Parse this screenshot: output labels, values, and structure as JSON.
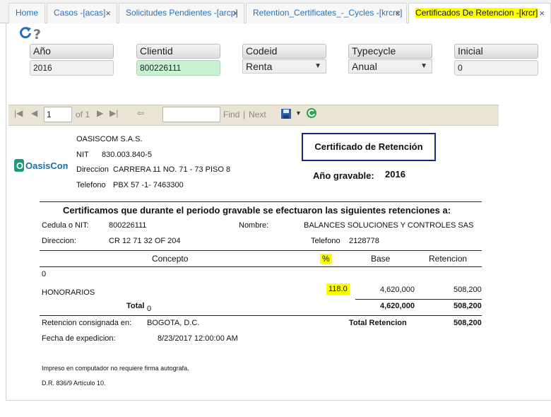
{
  "tabs": [
    {
      "label": "Home"
    },
    {
      "label": "Casos -[acas]"
    },
    {
      "label": "Solicitudes Pendientes -[arcp]"
    },
    {
      "label": "Retention_Certificates_-_Cycles -[krcrc]"
    },
    {
      "label": "Certificados De Retencion -[krcr]"
    }
  ],
  "params": {
    "anio": {
      "label": "Año",
      "value": "2016"
    },
    "clientid": {
      "label": "Clientid",
      "value": "800226111"
    },
    "codeid": {
      "label": "Codeid",
      "value": "Renta"
    },
    "typecycle": {
      "label": "Typecycle",
      "value": "Anual"
    },
    "inicial": {
      "label": "Inicial",
      "value": "0"
    }
  },
  "toolbar": {
    "page": "1",
    "of_label": "of 1",
    "find_label": "Find",
    "sep": "|",
    "next_label": "Next"
  },
  "report": {
    "company": "OASISCOM S.A.S.",
    "nit_label": "NIT",
    "nit_value": "830.003.840-5",
    "direccion_label": "Direccion",
    "direccion_value": "CARRERA  11 NO. 71 - 73 PISO 8",
    "telefono_label": "Telefono",
    "telefono_value": "PBX 57 -1- 7463300",
    "logo_text": "OasisCom",
    "cert_title": "Certificado de Retención",
    "anio_gravable_label": "Año gravable:",
    "anio_gravable_value": "2016",
    "heading": "Certificamos que durante el periodo gravable se efectuaron las siguientes retenciones a:",
    "cedula_label": "Cedula o NIT:",
    "cedula_value": "800226111",
    "nombre_label": "Nombre:",
    "nombre_value": "BALANCES SOLUCIONES Y CONTROLES SAS",
    "dir2_label": "Direccion:",
    "dir2_value": "CR 12 71 32 OF 204",
    "tel2_label": "Telefono",
    "tel2_value": "2128778",
    "col_concepto": "Concepto",
    "col_pct": "%",
    "col_base": "Base",
    "col_retencion": "Retencion",
    "group_zero": "0",
    "row_concepto": "HONORARIOS",
    "row_pct": "118.0",
    "row_base": "4,620,000",
    "row_retencion": "508,200",
    "total_label": "Total",
    "total_sub": "0",
    "total_base": "4,620,000",
    "total_retencion": "508,200",
    "consignada_label": "Retencion consignada en:",
    "consignada_value": "BOGOTA, D.C.",
    "total_ret_label": "Total Retencion",
    "total_ret_value": "508,200",
    "fecha_label": "Fecha de expedicion:",
    "fecha_value": "8/23/2017 12:00:00 AM",
    "note1": "Impreso en computador no requiere firma autografa.",
    "note2": "D.R. 836/9 Artículo 10."
  },
  "colors": {
    "tab_link": "#2a6fb8",
    "highlight": "#ffff00",
    "clientid_bg": "#c9f2d2",
    "cert_border": "#1a2a7a",
    "toolbar_bg": "#e9e4d6"
  }
}
